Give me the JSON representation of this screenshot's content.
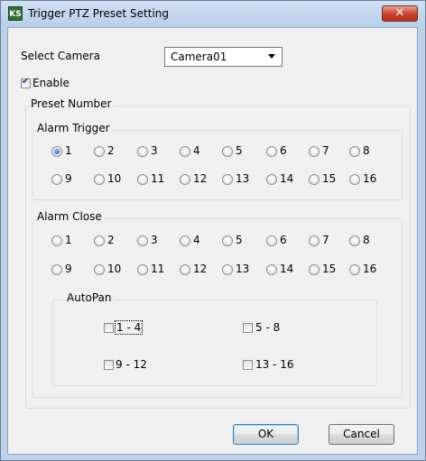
{
  "window": {
    "title": "Trigger PTZ Preset Setting",
    "icon_text": "KS",
    "close_glyph": "✕"
  },
  "select_camera": {
    "label": "Select Camera",
    "value": "Camera01"
  },
  "enable": {
    "label": "Enable",
    "checked": true
  },
  "preset_number": {
    "label": "Preset Number"
  },
  "alarm_trigger": {
    "label": "Alarm Trigger",
    "selected": "1",
    "options": [
      "1",
      "2",
      "3",
      "4",
      "5",
      "6",
      "7",
      "8",
      "9",
      "10",
      "11",
      "12",
      "13",
      "14",
      "15",
      "16"
    ]
  },
  "alarm_close": {
    "label": "Alarm Close",
    "options": [
      "1",
      "2",
      "3",
      "4",
      "5",
      "6",
      "7",
      "8",
      "9",
      "10",
      "11",
      "12",
      "13",
      "14",
      "15",
      "16"
    ]
  },
  "autopan": {
    "label": "AutoPan",
    "items": [
      {
        "label": "1 - 4",
        "checked": false
      },
      {
        "label": "5 - 8",
        "checked": false
      },
      {
        "label": "9 - 12",
        "checked": false
      },
      {
        "label": "13 - 16",
        "checked": false
      }
    ]
  },
  "buttons": {
    "ok": "OK",
    "cancel": "Cancel"
  }
}
